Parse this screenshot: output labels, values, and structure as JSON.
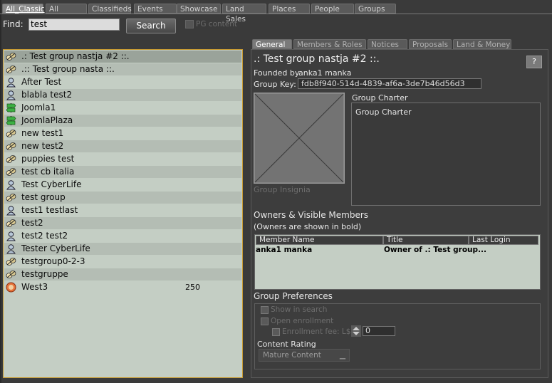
{
  "top_tabs": [
    "All_Classic",
    "All",
    "Classifieds",
    "Events",
    "Showcase",
    "Land Sales",
    "Places",
    "People",
    "Groups"
  ],
  "find": {
    "label": "Find:",
    "value": "test",
    "search_button": "Search",
    "pg_content_label": "PG content"
  },
  "results": [
    {
      "name": ".: Test group nastja #2 ::.",
      "icon": "group-icon",
      "count": ""
    },
    {
      "name": ".:: Test group nasta ::.",
      "icon": "group-icon",
      "count": ""
    },
    {
      "name": "After Test",
      "icon": "person-icon",
      "count": ""
    },
    {
      "name": "blabla test2",
      "icon": "person-icon",
      "count": ""
    },
    {
      "name": "Joomla1",
      "icon": "signpost-icon",
      "count": ""
    },
    {
      "name": "JoomlaPlaza",
      "icon": "signpost-icon",
      "count": ""
    },
    {
      "name": "new test1",
      "icon": "group-icon",
      "count": ""
    },
    {
      "name": "new test2",
      "icon": "group-icon",
      "count": ""
    },
    {
      "name": "puppies test",
      "icon": "group-icon",
      "count": ""
    },
    {
      "name": "test cb italia",
      "icon": "group-icon",
      "count": ""
    },
    {
      "name": "Test CyberLife",
      "icon": "person-icon",
      "count": ""
    },
    {
      "name": "test group",
      "icon": "group-icon",
      "count": ""
    },
    {
      "name": "test1 testlast",
      "icon": "person-icon",
      "count": ""
    },
    {
      "name": "test2",
      "icon": "group-icon",
      "count": ""
    },
    {
      "name": "test2 test2",
      "icon": "person-icon",
      "count": ""
    },
    {
      "name": "Tester CyberLife",
      "icon": "person-icon",
      "count": ""
    },
    {
      "name": "testgroup0-2-3",
      "icon": "group-icon",
      "count": ""
    },
    {
      "name": "testgruppe",
      "icon": "group-icon",
      "count": ""
    },
    {
      "name": "West3",
      "icon": "region-icon",
      "count": "250"
    }
  ],
  "right_tabs": [
    "General",
    "Members & Roles",
    "Notices",
    "Proposals",
    "Land & Money"
  ],
  "group": {
    "title": ".: Test group nastja #2 ::.",
    "help_label": "?",
    "founded_label": "Founded by",
    "founded_by": "anka1 manka",
    "key_label": "Group Key:",
    "key": "fdb8f940-514d-4839-af6a-3de7b46d56d3",
    "insignia_label": "Group Insignia",
    "charter_label": "Group Charter",
    "charter_text": "Group Charter"
  },
  "members": {
    "title": "Owners & Visible Members",
    "subtitle": "(Owners are shown in bold)",
    "columns": [
      "Member Name",
      "Title",
      "Last Login"
    ],
    "rows": [
      {
        "name": "anka1 manka",
        "title": "Owner of .: Test group...",
        "last_login": ""
      }
    ]
  },
  "prefs": {
    "title": "Group Preferences",
    "show_in_search": "Show in search",
    "open_enrollment": "Open enrollment",
    "enrollment_fee": "Enrollment fee: L$",
    "fee_value": "0",
    "content_rating_label": "Content Rating",
    "content_rating": "Mature Content"
  },
  "colors": {
    "list_bg": "#c4cec4",
    "selected_row": "#9aa39a",
    "focus_border": "#c89a30",
    "panel_bg": "#3a3a3a"
  }
}
